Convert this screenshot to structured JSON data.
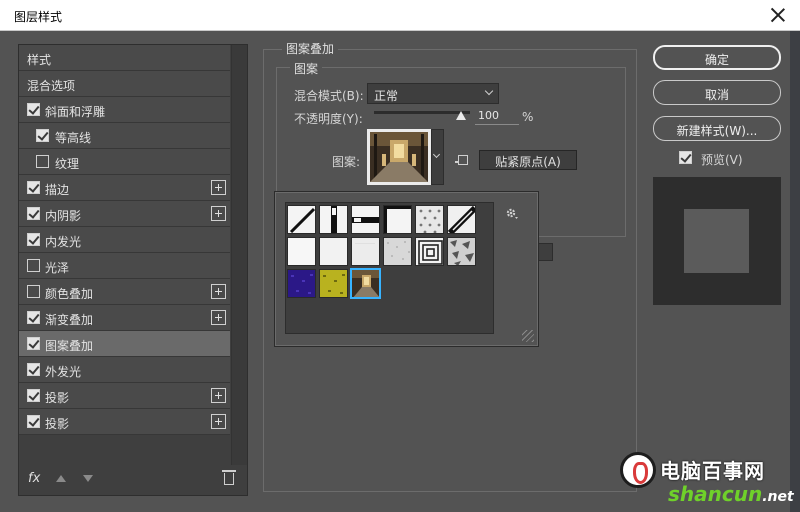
{
  "window": {
    "title": "图层样式"
  },
  "style_list": {
    "items": [
      {
        "label": "样式",
        "header": true,
        "checkbox": false,
        "checked": false,
        "plus": false,
        "indent": false,
        "selected": false
      },
      {
        "label": "混合选项",
        "header": true,
        "checkbox": false,
        "checked": false,
        "plus": false,
        "indent": false,
        "selected": false
      },
      {
        "label": "斜面和浮雕",
        "header": false,
        "checkbox": true,
        "checked": true,
        "plus": false,
        "indent": false,
        "selected": false
      },
      {
        "label": "等高线",
        "header": false,
        "checkbox": true,
        "checked": true,
        "plus": false,
        "indent": true,
        "selected": false
      },
      {
        "label": "纹理",
        "header": false,
        "checkbox": true,
        "checked": false,
        "plus": false,
        "indent": true,
        "selected": false
      },
      {
        "label": "描边",
        "header": false,
        "checkbox": true,
        "checked": true,
        "plus": true,
        "indent": false,
        "selected": false
      },
      {
        "label": "内阴影",
        "header": false,
        "checkbox": true,
        "checked": true,
        "plus": true,
        "indent": false,
        "selected": false
      },
      {
        "label": "内发光",
        "header": false,
        "checkbox": true,
        "checked": true,
        "plus": false,
        "indent": false,
        "selected": false
      },
      {
        "label": "光泽",
        "header": false,
        "checkbox": true,
        "checked": false,
        "plus": false,
        "indent": false,
        "selected": false
      },
      {
        "label": "颜色叠加",
        "header": false,
        "checkbox": true,
        "checked": false,
        "plus": true,
        "indent": false,
        "selected": false
      },
      {
        "label": "渐变叠加",
        "header": false,
        "checkbox": true,
        "checked": true,
        "plus": true,
        "indent": false,
        "selected": false
      },
      {
        "label": "图案叠加",
        "header": false,
        "checkbox": true,
        "checked": true,
        "plus": false,
        "indent": false,
        "selected": true
      },
      {
        "label": "外发光",
        "header": false,
        "checkbox": true,
        "checked": true,
        "plus": false,
        "indent": false,
        "selected": false
      },
      {
        "label": "投影",
        "header": false,
        "checkbox": true,
        "checked": true,
        "plus": true,
        "indent": false,
        "selected": false
      },
      {
        "label": "投影",
        "header": false,
        "checkbox": true,
        "checked": true,
        "plus": true,
        "indent": false,
        "selected": false
      }
    ],
    "footer": {
      "fx_label": "fx"
    }
  },
  "settings": {
    "group_title": "图案叠加",
    "subgroup_title": "图案",
    "blend_mode_label": "混合模式(B):",
    "blend_mode_value": "正常",
    "opacity_label": "不透明度(Y):",
    "opacity_value": "100",
    "opacity_unit": "%",
    "opacity_level": 100,
    "pattern_label": "图案:",
    "snap_origin_button": "贴紧原点(A)"
  },
  "pattern_picker": {
    "tiles": [
      "diagonal-line-light",
      "vertical-bar",
      "horizontal-bar",
      "black-frame",
      "dots-light",
      "diagonal-stripes",
      "white-paper",
      "white-paper-2",
      "white-paper-3",
      "grey-noise",
      "square-spiral",
      "crumpled-paper",
      "purple-grain",
      "yellow-grain",
      "interior-photo"
    ],
    "selected_index": 14
  },
  "buttons": {
    "ok": "确定",
    "cancel": "取消",
    "new_style": "新建样式(W)...",
    "preview_label": "预览(V)",
    "preview_checked": true
  },
  "watermark": {
    "title": "电脑百事网",
    "domain_main": "shancun",
    "domain_tld": ".net"
  },
  "colors": {
    "dialog_bg": "#535353",
    "selected_row": "#6a6a6a",
    "selection_outline": "#37b3ff",
    "watermark_green": "#6fd12a"
  }
}
